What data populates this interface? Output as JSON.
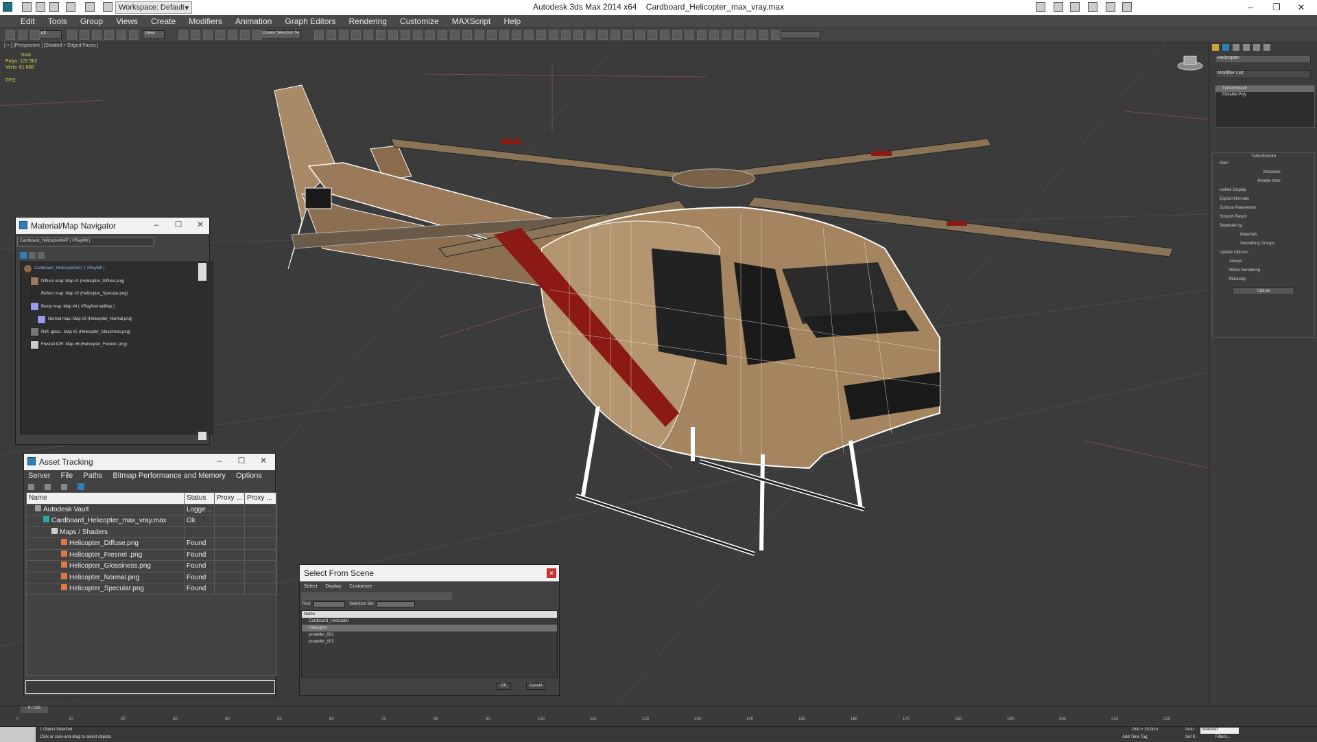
{
  "titlebar": {
    "workspace": "Workspace: Default",
    "app_title": "Autodesk 3ds Max  2014 x64",
    "file_title": "Cardboard_Helicopter_max_vray.max"
  },
  "menu": [
    "Edit",
    "Tools",
    "Group",
    "Views",
    "Create",
    "Modifiers",
    "Animation",
    "Graph Editors",
    "Rendering",
    "Customize",
    "MAXScript",
    "Help"
  ],
  "toolbar": {
    "selection_filter": "All",
    "ref_coord": "View",
    "named_selection": "Create Selection Se"
  },
  "viewport": {
    "label": "[ + ] [Perspective ] [Shaded + Edged Faces ]",
    "stats_total": "Total",
    "stats_polys": "Polys:  122 962",
    "stats_verts": "Verts:   61 868",
    "stats_fps": "FPS:"
  },
  "command_panel": {
    "object_name": "Helicopter",
    "modifier_list": "Modifier List",
    "stack": [
      "TurboSmooth",
      "Editable Poly"
    ],
    "turbosmooth": {
      "title": "TurboSmooth",
      "main": "Main",
      "iterations": "Iterations:",
      "render_iters": "Render Iters:",
      "isoline": "Isoline Display",
      "explicit_normals": "Explicit Normals",
      "surface_params": "Surface Parameters",
      "smooth_result": "Smooth Result",
      "separate_by": "Separate by:",
      "materials": "Materials",
      "smoothing_groups": "Smoothing Groups",
      "update_options": "Update Options",
      "always": "Always",
      "when_rendering": "When Rendering",
      "manually": "Manually",
      "update": "Update"
    }
  },
  "mat_nav": {
    "title": "Material/Map Navigator",
    "field": "Cardboard_HelicopterMAT  ( VRayMtl )",
    "items": [
      "Cardboard_HelicopterMAT  ( VRayMtl )",
      "Diffuse map: Map #1 (Helicopter_Diffuse.png)",
      "Reflect map: Map #2 (Helicopter_Specular.png)",
      "Bump map: Map #4  ( VRayNormalMap )",
      "Normal map: Map #3 (Helicopter_Normal.png)",
      "Refl. gloss.: Map #5 (Helicopter_Glossiness.png)",
      "Fresnel IOR: Map #6 (Helicopter_Fresnel .png)"
    ]
  },
  "asset_tracking": {
    "title": "Asset Tracking",
    "menu": [
      "Server",
      "File",
      "Paths",
      "Bitmap Performance and Memory",
      "Options"
    ],
    "columns": [
      "Name",
      "Status",
      "Proxy ...",
      "Proxy ..."
    ],
    "rows": [
      {
        "name": "Autodesk Vault",
        "status": "Logge..."
      },
      {
        "name": "Cardboard_Helicopter_max_vray.max",
        "status": "Ok"
      },
      {
        "name": "Maps / Shaders",
        "status": ""
      },
      {
        "name": "Helicopter_Diffuse.png",
        "status": "Found"
      },
      {
        "name": "Helicopter_Fresnel .png",
        "status": "Found"
      },
      {
        "name": "Helicopter_Glossiness.png",
        "status": "Found"
      },
      {
        "name": "Helicopter_Normal.png",
        "status": "Found"
      },
      {
        "name": "Helicopter_Specular.png",
        "status": "Found"
      }
    ]
  },
  "select_scene": {
    "title": "Select From Scene",
    "menu": [
      "Select",
      "Display",
      "Customize"
    ],
    "find_label": "Find:",
    "selection_set": "Selection Set:",
    "column": "Name",
    "items": [
      "Cardboard_Helicopter",
      "Helicopter",
      "propeller_001",
      "propeller_002"
    ],
    "ok": "OK",
    "cancel": "Cancel"
  },
  "timeline": {
    "frame": "0 / 225",
    "ticks": [
      "0",
      "10",
      "20",
      "30",
      "40",
      "50",
      "60",
      "70",
      "80",
      "90",
      "100",
      "110",
      "120",
      "130",
      "140",
      "150",
      "160",
      "170",
      "180",
      "190",
      "200",
      "210",
      "220"
    ]
  },
  "status": {
    "selected": "1 Object Selected",
    "hint": "Click or click-and-drag to select objects",
    "grid": "Grid = 10,0cm",
    "auto": "Auto",
    "selected_mode": "Selected",
    "set_key": "Set K.",
    "filters": "Filters...",
    "add_time_tag": "Add Time Tag"
  },
  "colors": {
    "accent": "#2e7fb8",
    "viewport_bg": "#3b3b3b",
    "cardboard": "#9a7a58",
    "stripe": "#8b1a14"
  }
}
